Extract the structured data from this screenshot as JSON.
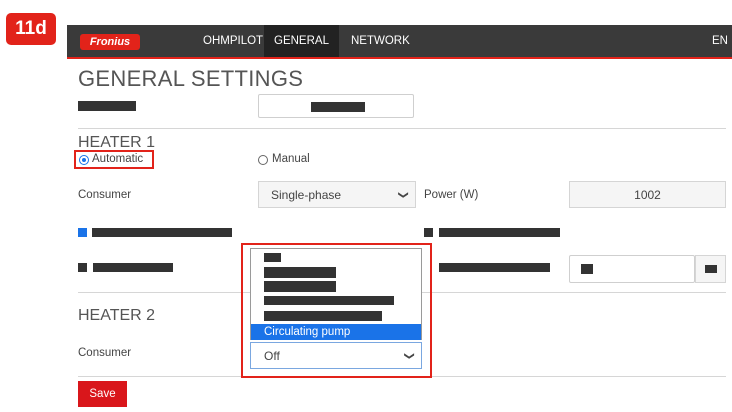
{
  "step_badge": "11d",
  "nav": {
    "logo": "Fronius",
    "tabs": [
      {
        "label": "OHMPILOT"
      },
      {
        "label": "GENERAL"
      },
      {
        "label": "NETWORK"
      }
    ],
    "language": "EN",
    "active_tab": "GENERAL"
  },
  "page": {
    "title": "GENERAL SETTINGS"
  },
  "heater1": {
    "title": "HEATER 1",
    "mode_automatic": "Automatic",
    "mode_manual": "Manual",
    "selected_mode": "Automatic",
    "consumer_label": "Consumer",
    "consumer_value": "Single-phase",
    "power_label": "Power (W)",
    "power_value": "1002"
  },
  "heater2": {
    "title": "HEATER 2",
    "consumer_label": "Consumer",
    "consumer_value": "Off",
    "dropdown_highlighted_option": "Circulating pump"
  },
  "save_label": "Save",
  "colors": {
    "accent": "#e2231a",
    "selection": "#1a73e8",
    "navbar": "#3a3a3a"
  },
  "icons": {
    "dropdown": "chevron-down-icon",
    "radio": "radio-icon"
  }
}
